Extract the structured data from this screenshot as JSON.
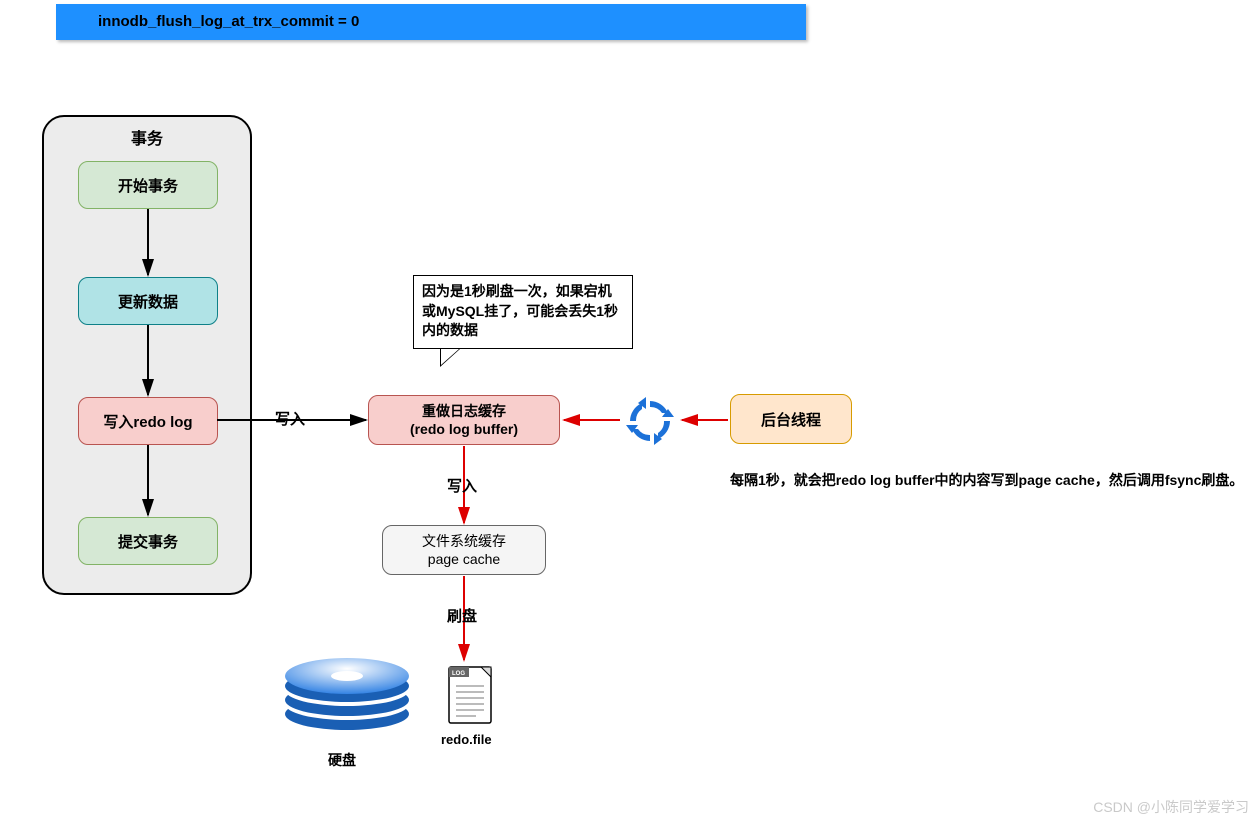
{
  "header": {
    "title": "innodb_flush_log_at_trx_commit = 0"
  },
  "transaction": {
    "title": "事务",
    "start": "开始事务",
    "update": "更新数据",
    "redo": "写入redo log",
    "commit": "提交事务"
  },
  "labels": {
    "write1": "写入",
    "write2": "写入",
    "flush": "刷盘"
  },
  "redo_buffer": {
    "line1": "重做日志缓存",
    "line2": "(redo log buffer)"
  },
  "page_cache": {
    "line1": "文件系统缓存",
    "line2": "page cache"
  },
  "bg_thread": "后台线程",
  "note": "因为是1秒刷盘一次，如果宕机或MySQL挂了，可能会丢失1秒内的数据",
  "sidebar": "每隔1秒，就会把redo log buffer中的内容写到page cache，然后调用fsync刷盘。",
  "disk": {
    "label": "硬盘"
  },
  "redo_file": {
    "label": "redo.file"
  },
  "watermark": "CSDN @小陈同学爱学习"
}
